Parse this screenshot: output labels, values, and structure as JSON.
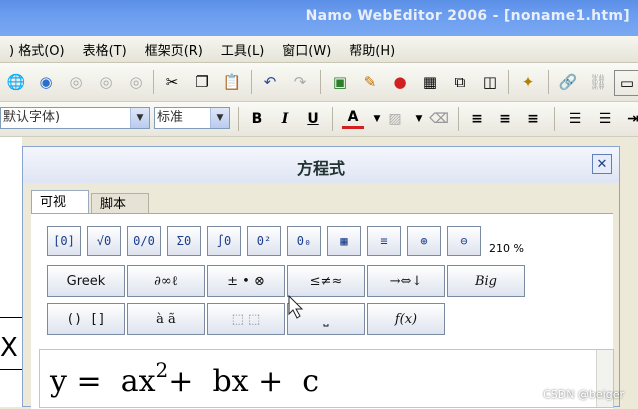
{
  "window": {
    "title": "Namo WebEditor 2006 - [noname1.htm]"
  },
  "menu": [
    ") 格式(O)",
    "表格(T)",
    "框架页(R)",
    "工具(L)",
    "窗口(W)",
    "帮助(H)"
  ],
  "toolbar2": {
    "font": "默认字体)",
    "style": "标准",
    "bold": "B",
    "italic": "I",
    "underline": "U",
    "fontcolor": "A"
  },
  "dialog": {
    "title": "方程式",
    "close": "✕",
    "tabs": [
      "可视",
      "脚本"
    ],
    "row1": [
      "[0]",
      "√0",
      "0/0",
      "Σ0",
      "∫0",
      "0²",
      "0₀",
      "▦",
      "≡",
      "⊕",
      "⊖"
    ],
    "zoom": "210 %",
    "row2": [
      "Greek",
      "∂∞ℓ",
      "± • ⊗",
      "≤≠≈",
      "→⇔↓",
      "Big"
    ],
    "row3": [
      "() []",
      "à ã",
      "⬚ ⬚",
      "⎵",
      "f(x)"
    ],
    "equation": {
      "y": "y =  ax",
      "exp": "2",
      "rest": "+  bx +  c"
    }
  },
  "watermark": "CSDN @beiger",
  "colors": {
    "titlebar": "#6b9df0",
    "dialog_bg": "#ece9d8",
    "button_text": "#1a3c8c"
  }
}
